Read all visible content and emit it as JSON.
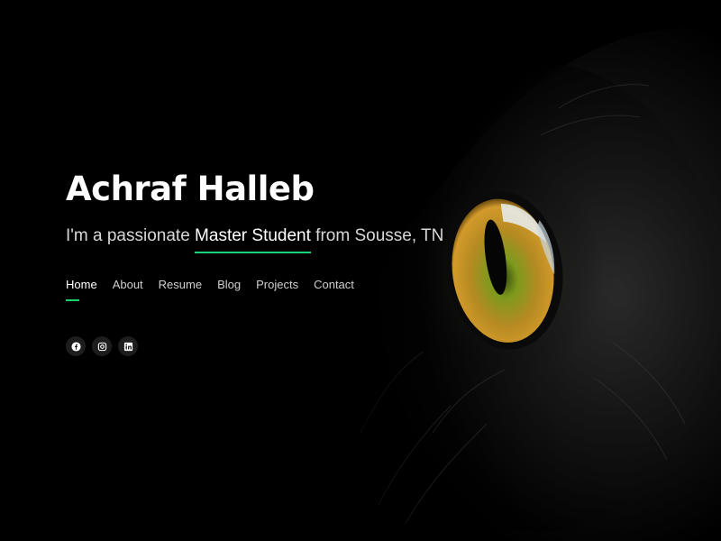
{
  "hero": {
    "name": "Achraf Halleb",
    "tagline_prefix": "I'm a passionate ",
    "tagline_highlight": "Master Student",
    "tagline_suffix": " from Sousse, TN"
  },
  "nav": {
    "items": [
      {
        "label": "Home",
        "active": true
      },
      {
        "label": "About"
      },
      {
        "label": "Resume"
      },
      {
        "label": "Blog"
      },
      {
        "label": "Projects"
      },
      {
        "label": "Contact"
      }
    ]
  },
  "social": {
    "icons": [
      "facebook-icon",
      "instagram-icon",
      "linkedin-icon"
    ]
  },
  "colors": {
    "accent": "#18d26e",
    "background": "#000000"
  }
}
